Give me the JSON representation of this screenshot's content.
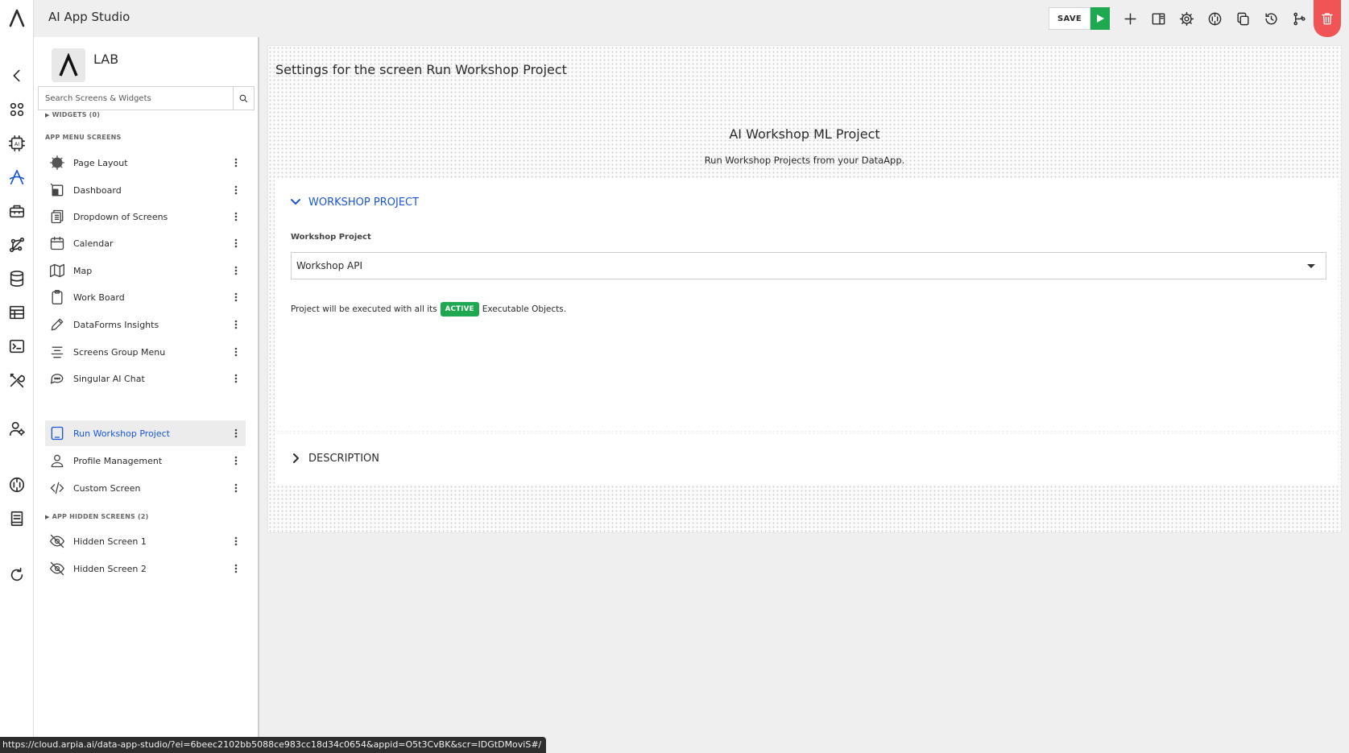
{
  "app": {
    "title": "AI App Studio"
  },
  "toolbar": {
    "save_label": "SAVE"
  },
  "lab": {
    "name": "LAB"
  },
  "search": {
    "placeholder": "Search Screens & Widgets"
  },
  "sidebar": {
    "widgets_label": "WIDGETS (0)",
    "menu_screens_label": "APP MENU SCREENS",
    "hidden_screens_label": "APP HIDDEN SCREENS (2)",
    "items": [
      {
        "label": "Page Layout"
      },
      {
        "label": "Dashboard"
      },
      {
        "label": "Dropdown of Screens"
      },
      {
        "label": "Calendar"
      },
      {
        "label": "Map"
      },
      {
        "label": "Work Board"
      },
      {
        "label": "DataForms Insights"
      },
      {
        "label": "Screens Group Menu"
      },
      {
        "label": "Singular AI Chat"
      },
      {
        "label": "Run Workshop Project"
      },
      {
        "label": "Profile Management"
      },
      {
        "label": "Custom Screen"
      }
    ],
    "hidden_items": [
      {
        "label": "Hidden Screen 1"
      },
      {
        "label": "Hidden Screen 2"
      }
    ]
  },
  "main": {
    "screen_title": "Settings for the screen Run Workshop Project",
    "project_title": "AI Workshop ML Project",
    "project_subtitle": "Run Workshop Projects from your DataApp.",
    "section_workshop": "WORKSHOP PROJECT",
    "field_label": "Workshop Project",
    "field_value": "Workshop API",
    "note_before": "Project will be executed with all its",
    "note_badge": "ACTIVE",
    "note_after": "Executable Objects.",
    "section_description": "DESCRIPTION"
  },
  "status": {
    "url": "https://cloud.arpia.ai/data-app-studio/?ei=6beec2102bb5088ce983cc18d34c0654&appid=O5t3CvBK&scr=IDGtDMoviS#/"
  },
  "colors": {
    "accent": "#1a56d6",
    "run_green": "#1ea950",
    "delete_red": "#f15454"
  }
}
